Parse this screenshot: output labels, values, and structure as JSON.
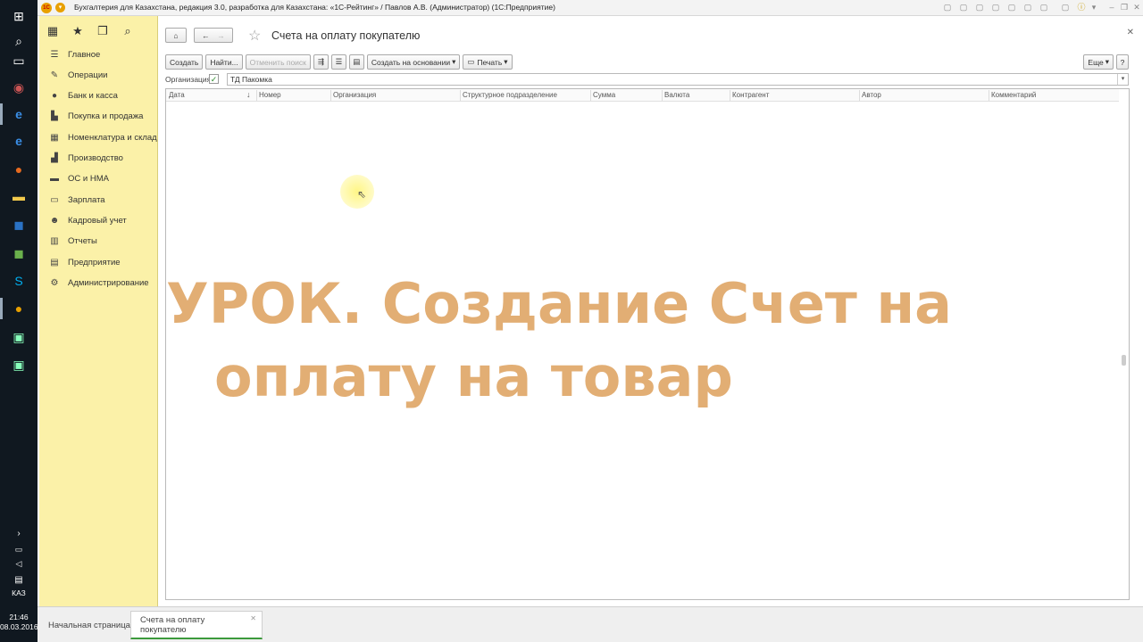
{
  "window": {
    "title": "Бухгалтерия для Казахстана, редакция 3.0, разработка для Казахстана: «1С-Рейтинг» / Павлов А.В. (Администратор)  (1С:Предприятие)"
  },
  "taskbar": {
    "time": "21:46",
    "date": "08.03.2016",
    "lang": "КАЗ"
  },
  "sidebar": {
    "items": [
      {
        "label": "Главное",
        "icon": "list-icon"
      },
      {
        "label": "Операции",
        "icon": "pencil-icon"
      },
      {
        "label": "Банк и касса",
        "icon": "coin-icon"
      },
      {
        "label": "Покупка и продажа",
        "icon": "cart-icon"
      },
      {
        "label": "Номенклатура и склад",
        "icon": "grid-icon"
      },
      {
        "label": "Производство",
        "icon": "factory-icon"
      },
      {
        "label": "ОС и НМА",
        "icon": "truck-icon"
      },
      {
        "label": "Зарплата",
        "icon": "wallet-icon"
      },
      {
        "label": "Кадровый учет",
        "icon": "people-icon"
      },
      {
        "label": "Отчеты",
        "icon": "chart-icon"
      },
      {
        "label": "Предприятие",
        "icon": "building-icon"
      },
      {
        "label": "Администрирование",
        "icon": "gear-icon"
      }
    ]
  },
  "form": {
    "title": "Счета на оплату покупателю",
    "toolbar": {
      "create": "Создать",
      "find": "Найти...",
      "cancel_search": "Отменить поиск",
      "create_based": "Создать на основании",
      "print": "Печать",
      "more": "Еще",
      "help": "?"
    },
    "org_filter": {
      "label": "Организация:",
      "value": "ТД Пакомка"
    },
    "columns": [
      "Дата",
      "Номер",
      "Организация",
      "Структурное подразделение",
      "Сумма",
      "Валюта",
      "Контрагент",
      "Автор",
      "Комментарий"
    ]
  },
  "overlay": {
    "line1": "УРОК. Создание Счет на",
    "line2": "оплату на товар"
  },
  "tabs": [
    {
      "label": "Начальная страница"
    },
    {
      "label": "Счета на оплату покупателю"
    }
  ]
}
